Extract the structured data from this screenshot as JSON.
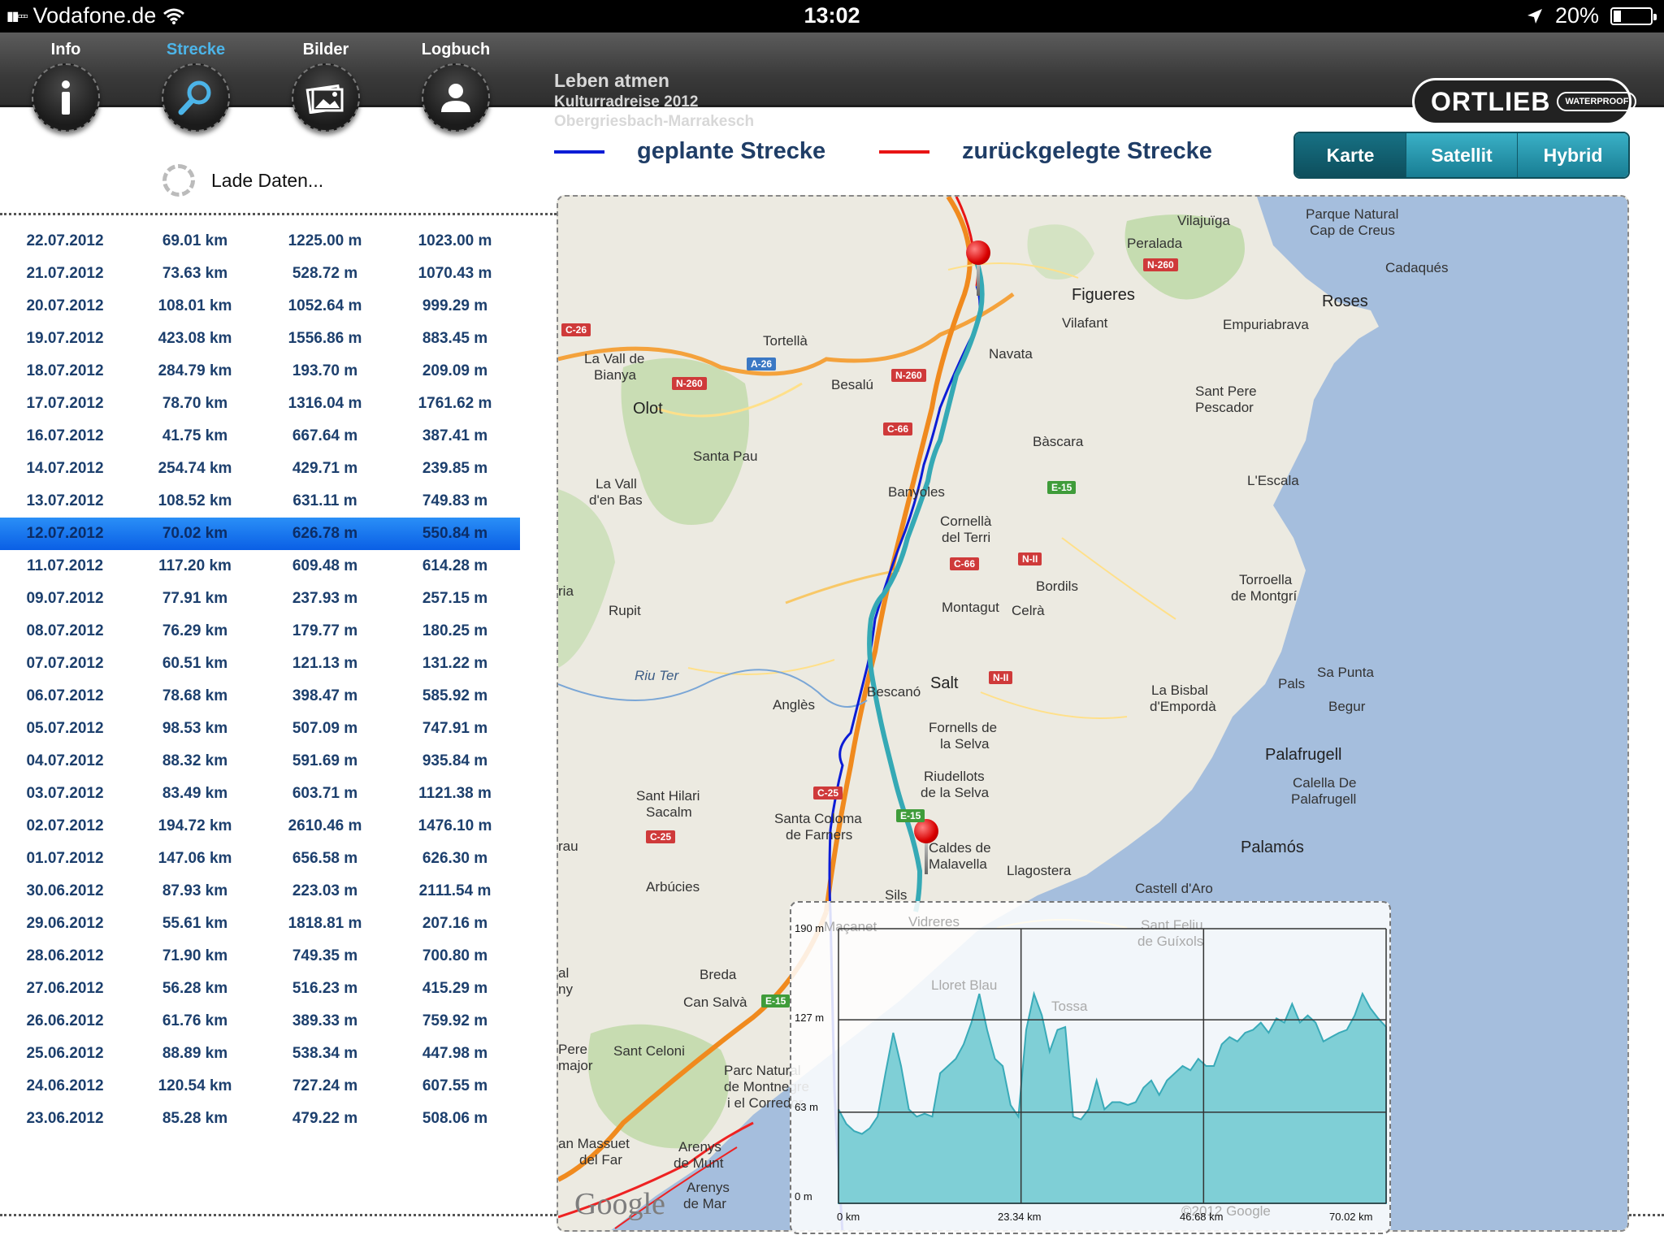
{
  "status_bar": {
    "carrier": "Vodafone.de",
    "time": "13:02",
    "battery": "20%",
    "battery_level": 0.2
  },
  "nav": {
    "tabs": [
      {
        "label": "Info",
        "icon": "info-icon"
      },
      {
        "label": "Strecke",
        "icon": "search-icon",
        "active": true
      },
      {
        "label": "Bilder",
        "icon": "photos-icon"
      },
      {
        "label": "Logbuch",
        "icon": "user-icon"
      }
    ],
    "title": "Leben atmen",
    "subtitle1": "Kulturradreise 2012",
    "subtitle2": "Obergriesbach-Marrakesch",
    "logo": {
      "brand": "ORTLIEB",
      "tag": "WATERPROOF"
    }
  },
  "loading_text": "Lade Daten...",
  "legend": {
    "planned": {
      "label": "geplante Strecke",
      "color": "#0b1cd6"
    },
    "done": {
      "label": "zurückgelegte Strecke",
      "color": "#e81414"
    }
  },
  "map_type": {
    "options": [
      "Karte",
      "Satellit",
      "Hybrid"
    ],
    "selected": "Karte"
  },
  "trips": [
    {
      "date": "22.07.2012",
      "distance": "69.01 km",
      "ascent": "1225.00 m",
      "descent": "1023.00 m"
    },
    {
      "date": "21.07.2012",
      "distance": "73.63 km",
      "ascent": "528.72 m",
      "descent": "1070.43 m"
    },
    {
      "date": "20.07.2012",
      "distance": "108.01 km",
      "ascent": "1052.64 m",
      "descent": "999.29 m"
    },
    {
      "date": "19.07.2012",
      "distance": "423.08 km",
      "ascent": "1556.86 m",
      "descent": "883.45 m"
    },
    {
      "date": "18.07.2012",
      "distance": "284.79 km",
      "ascent": "193.70 m",
      "descent": "209.09 m"
    },
    {
      "date": "17.07.2012",
      "distance": "78.70 km",
      "ascent": "1316.04 m",
      "descent": "1761.62 m"
    },
    {
      "date": "16.07.2012",
      "distance": "41.75 km",
      "ascent": "667.64 m",
      "descent": "387.41 m"
    },
    {
      "date": "14.07.2012",
      "distance": "254.74 km",
      "ascent": "429.71 m",
      "descent": "239.85 m"
    },
    {
      "date": "13.07.2012",
      "distance": "108.52 km",
      "ascent": "631.11 m",
      "descent": "749.83 m"
    },
    {
      "date": "12.07.2012",
      "distance": "70.02 km",
      "ascent": "626.78 m",
      "descent": "550.84 m",
      "selected": true
    },
    {
      "date": "11.07.2012",
      "distance": "117.20 km",
      "ascent": "609.48 m",
      "descent": "614.28 m"
    },
    {
      "date": "09.07.2012",
      "distance": "77.91 km",
      "ascent": "237.93 m",
      "descent": "257.15 m"
    },
    {
      "date": "08.07.2012",
      "distance": "76.29 km",
      "ascent": "179.77 m",
      "descent": "180.25 m"
    },
    {
      "date": "07.07.2012",
      "distance": "60.51 km",
      "ascent": "121.13 m",
      "descent": "131.22 m"
    },
    {
      "date": "06.07.2012",
      "distance": "78.68 km",
      "ascent": "398.47 m",
      "descent": "585.92 m"
    },
    {
      "date": "05.07.2012",
      "distance": "98.53 km",
      "ascent": "507.09 m",
      "descent": "747.91 m"
    },
    {
      "date": "04.07.2012",
      "distance": "88.32 km",
      "ascent": "591.69 m",
      "descent": "935.84 m"
    },
    {
      "date": "03.07.2012",
      "distance": "83.49 km",
      "ascent": "603.71 m",
      "descent": "1121.38 m"
    },
    {
      "date": "02.07.2012",
      "distance": "194.72 km",
      "ascent": "2610.46 m",
      "descent": "1476.10 m"
    },
    {
      "date": "01.07.2012",
      "distance": "147.06 km",
      "ascent": "656.58 m",
      "descent": "626.30 m"
    },
    {
      "date": "30.06.2012",
      "distance": "87.93 km",
      "ascent": "223.03 m",
      "descent": "2111.54 m"
    },
    {
      "date": "29.06.2012",
      "distance": "55.61 km",
      "ascent": "1818.81 m",
      "descent": "207.16 m"
    },
    {
      "date": "28.06.2012",
      "distance": "71.90 km",
      "ascent": "749.35 m",
      "descent": "700.80 m"
    },
    {
      "date": "27.06.2012",
      "distance": "56.28 km",
      "ascent": "516.23 m",
      "descent": "415.29 m"
    },
    {
      "date": "26.06.2012",
      "distance": "61.76 km",
      "ascent": "389.33 m",
      "descent": "759.92 m"
    },
    {
      "date": "25.06.2012",
      "distance": "88.89 km",
      "ascent": "538.34 m",
      "descent": "447.98 m"
    },
    {
      "date": "24.06.2012",
      "distance": "120.54 km",
      "ascent": "727.24 m",
      "descent": "607.55 m"
    },
    {
      "date": "23.06.2012",
      "distance": "85.28 km",
      "ascent": "479.22 m",
      "descent": "508.06 m"
    }
  ],
  "map": {
    "attribution": "Google",
    "copyright": "©2012 Google",
    "places": {
      "vilajuiga": "Vilajuïga",
      "peralada": "Peralada",
      "parque": "Parque Natural",
      "parque2": "Cap de Creus",
      "cadaques": "Cadaqués",
      "figueres": "Figueres",
      "roses": "Roses",
      "vilafant": "Vilafant",
      "empuriabrava": "Empuriabrava",
      "tortella": "Tortellà",
      "lavall": "La Vall de",
      "lavall2": "Bianya",
      "besalu": "Besalú",
      "navata": "Navata",
      "santpere": "Sant Pere",
      "santpere2": "Pescador",
      "olot": "Olot",
      "bascara": "Bàscara",
      "santapau": "Santa Pau",
      "lavallbas": "La Vall",
      "lavallbas2": "d'en Bas",
      "lescala": "L'Escala",
      "banyoles": "Banyoles",
      "cornella": "Cornellà",
      "cornella2": "del Terri",
      "bordils": "Bordils",
      "torroella": "Torroella",
      "torroella2": "de Montgrí",
      "rupit": "Rupit",
      "montagut": "Montagut",
      "celra": "Celrà",
      "riuter": "Riu Ter",
      "salt": "Salt",
      "pals": "Pals",
      "sapunta": "Sa Punta",
      "angles": "Anglès",
      "bescano": "Bescanó",
      "labisbal": "La Bisbal",
      "labisbal2": "d'Empordà",
      "begur": "Begur",
      "fornells": "Fornells de",
      "fornells2": "la Selva",
      "palafrugell": "Palafrugell",
      "riudellots": "Riudellots",
      "riudellots2": "de la Selva",
      "calella": "Calella De",
      "calella2": "Palafrugell",
      "santhilari": "Sant Hilari",
      "santhilari2": "Sacalm",
      "santacoloma": "Santa Coloma",
      "santacoloma2": "de Farners",
      "caldes": "Caldes de",
      "caldes2": "Malavella",
      "llagostera": "Llagostera",
      "palamos": "Palamós",
      "arbucies": "Arbúcies",
      "sils": "Sils",
      "castell": "Castell d'Aro",
      "breda": "Breda",
      "cansalva": "Can Salvà",
      "pere": "Pere",
      "major": "major",
      "santceloni": "Sant Celoni",
      "parcm": "Parc Natural",
      "parcm2": "de Montnegre",
      "parcm3": "i el Corredor",
      "massuet": "an Massuet",
      "massuet2": "del Far",
      "arenys": "Arenys",
      "arenys2": "de Munt",
      "arenysmar": "Arenys",
      "arenysmar2": "de Mar",
      "ria": "ria",
      "rau": "rau",
      "al": "al",
      "ny": "ny",
      "lloret": "Lloret Blau",
      "tossa": "Tossa",
      "maçanet": "Maçanet",
      "vidreres": "Vidreres",
      "santfeliu": "Sant Feliu",
      "santfeliu2": "de Guíxols"
    },
    "roads": {
      "n260a": "N-260",
      "n260b": "N-260",
      "n260c": "N-260",
      "c26": "C-26",
      "a26": "A-26",
      "c66a": "C-66",
      "c66b": "C-66",
      "e15a": "E-15",
      "e15b": "E-15",
      "e15c": "E-15",
      "n2a": "N-II",
      "n2b": "N-II",
      "c25a": "C-25",
      "c25b": "C-25"
    }
  },
  "chart_data": {
    "type": "area",
    "title": "",
    "xlabel": "",
    "ylabel": "",
    "x_ticks": [
      "0 km",
      "23.34 km",
      "46.68 km",
      "70.02 km"
    ],
    "y_ticks": [
      "190 m",
      "127 m",
      "63 m",
      "0 m"
    ],
    "xlim": [
      0,
      70.02
    ],
    "ylim": [
      0,
      190
    ],
    "grid": true,
    "x": [
      0,
      1,
      2,
      3,
      4,
      5,
      6,
      7,
      8,
      9,
      10,
      11,
      12,
      13,
      14,
      15,
      16,
      17,
      18,
      19,
      20,
      21,
      22,
      23,
      24,
      25,
      26,
      27,
      28,
      29,
      30,
      31,
      32,
      33,
      34,
      35,
      36,
      37,
      38,
      39,
      40,
      41,
      42,
      43,
      44,
      45,
      46,
      47,
      48,
      49,
      50,
      51,
      52,
      53,
      54,
      55,
      56,
      57,
      58,
      59,
      60,
      61,
      62,
      63,
      64,
      65,
      66,
      67,
      68,
      69,
      70.02
    ],
    "series": [
      {
        "values": [
          65,
          55,
          50,
          48,
          52,
          60,
          90,
          118,
          95,
          65,
          60,
          62,
          60,
          90,
          95,
          100,
          110,
          125,
          145,
          120,
          100,
          95,
          68,
          60,
          120,
          145,
          130,
          105,
          120,
          122,
          60,
          58,
          65,
          85,
          65,
          70,
          70,
          68,
          70,
          80,
          85,
          75,
          85,
          90,
          95,
          92,
          100,
          95,
          95,
          110,
          115,
          112,
          118,
          120,
          125,
          118,
          128,
          125,
          138,
          125,
          130,
          125,
          112,
          115,
          118,
          120,
          130,
          145,
          135,
          128,
          122
        ],
        "color": "#39aab8"
      }
    ]
  }
}
